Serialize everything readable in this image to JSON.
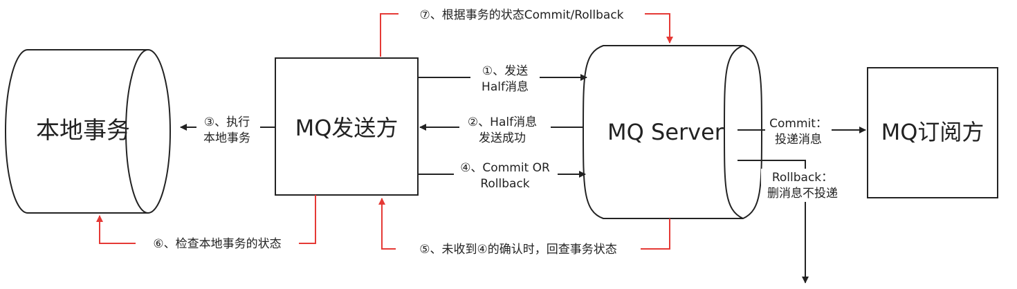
{
  "nodes": {
    "local_transaction": "本地事务",
    "producer": "MQ发送方",
    "server": "MQ Server",
    "subscriber": "MQ订阅方"
  },
  "labels": {
    "step1_line1": "①、发送",
    "step1_line2": "Half消息",
    "step2_line1": "②、Half消息",
    "step2_line2": "发送成功",
    "step3_line1": "③、执行",
    "step3_line2": "本地事务",
    "step4_line1": "④、Commit OR",
    "step4_line2": "Rollback",
    "step5": "⑤、未收到④的确认时，回查事务状态",
    "step6": "⑥、检查本地事务的状态",
    "step7": "⑦、根据事务的状态Commit/Rollback",
    "commit_line1": "Commit：",
    "commit_line2": "投递消息",
    "rollback_line1": "Rollback：",
    "rollback_line2": "删消息不投递"
  },
  "colors": {
    "stroke": "#222222",
    "check_flow": "#e53935",
    "background": "#ffffff"
  }
}
